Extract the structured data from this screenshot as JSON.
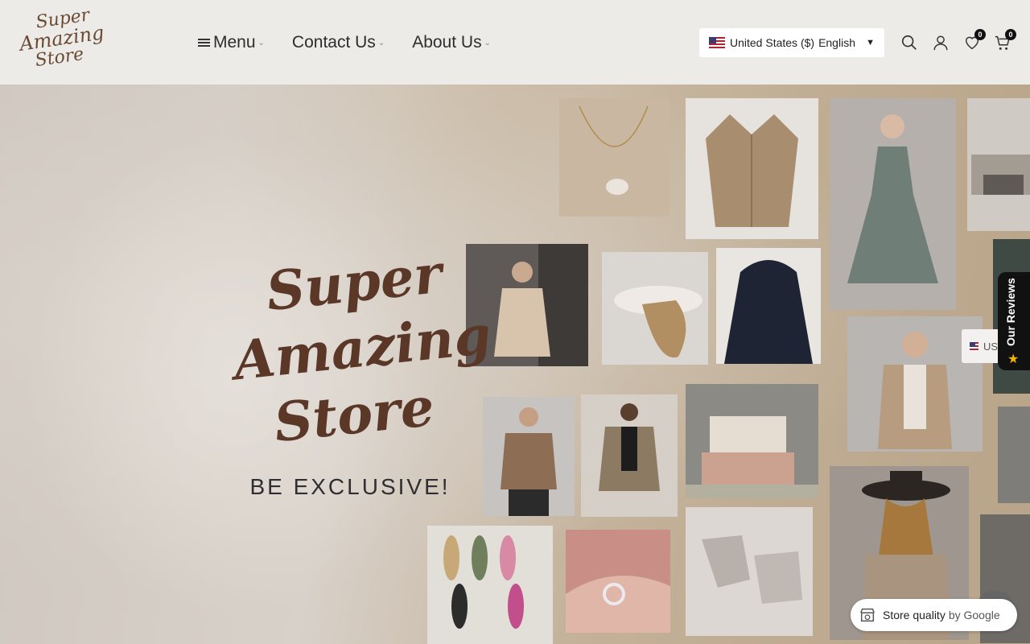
{
  "logo": {
    "lines": [
      "Super",
      "Amazing",
      "Store"
    ]
  },
  "nav": {
    "items": [
      {
        "label": "Menu"
      },
      {
        "label": "Contact Us"
      },
      {
        "label": "About Us"
      }
    ]
  },
  "language_selector": {
    "country": "United States ($)",
    "language": "English"
  },
  "header_icons": {
    "search": "search-icon",
    "account": "user-icon",
    "wishlist": "heart-icon",
    "wishlist_count": "0",
    "cart": "cart-icon",
    "cart_count": "0"
  },
  "hero": {
    "title_lines": [
      "Super",
      "Amazing",
      "Store"
    ],
    "subtitle": "BE EXCLUSIVE!"
  },
  "reviews_tab": {
    "label": "Our Reviews"
  },
  "mini_lang": {
    "label": "US"
  },
  "google_badge": {
    "label": "Store quality",
    "by": "by Google"
  },
  "colors": {
    "brand_brown": "#5a3727",
    "header_bg": "#ecebe8",
    "badge_bg": "#111111"
  }
}
